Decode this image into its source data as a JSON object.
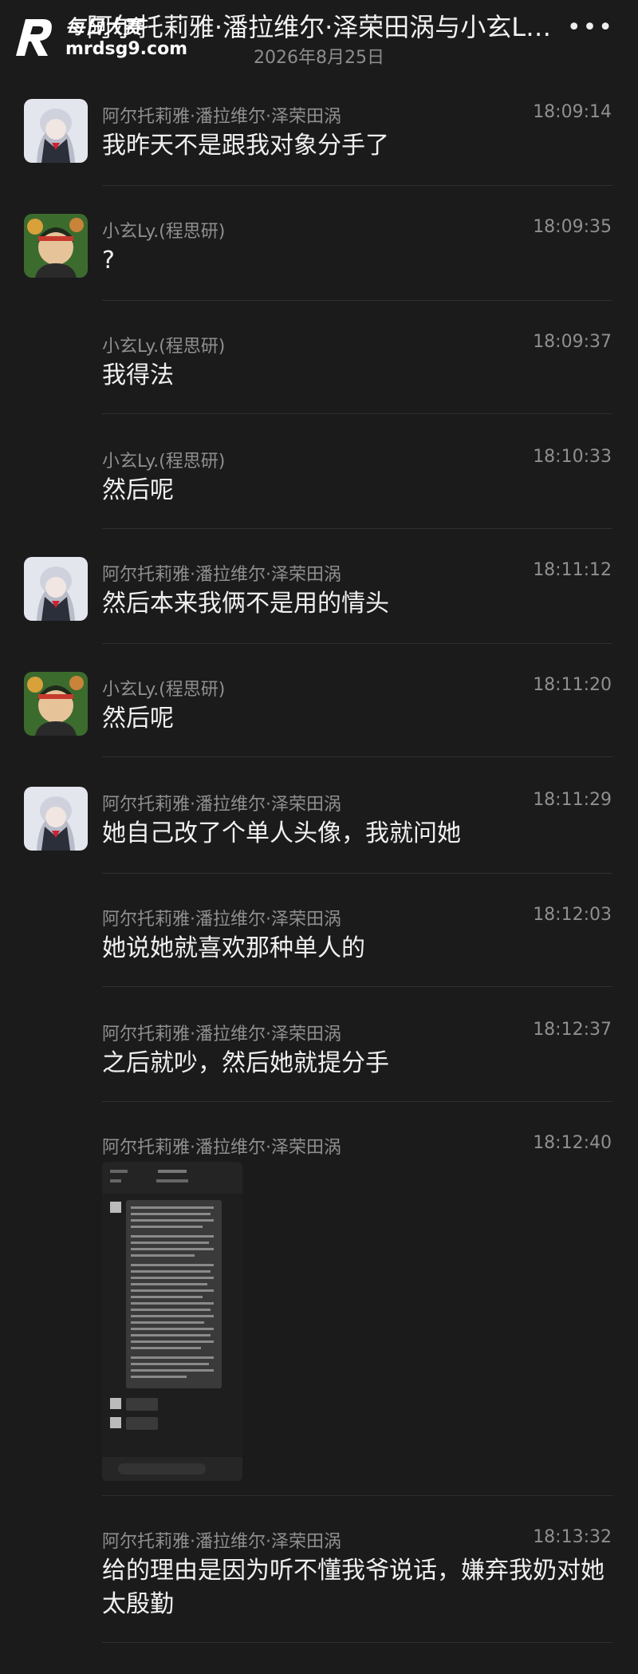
{
  "header": {
    "title": "阿尔托莉雅·潘拉维尔·泽荣田涡与小玄L…",
    "date": "2026年8月25日",
    "more_icon": "more-icon"
  },
  "watermark": {
    "cn": "每日大赛",
    "url": "mrdsg9.com"
  },
  "colors": {
    "background": "#1b1b1b",
    "name": "#8f8f8f",
    "text": "#f0f0f0"
  },
  "messages": [
    {
      "name": "阿尔托莉雅·潘拉维尔·泽荣田涡",
      "time": "18:09:14",
      "text": "我昨天不是跟我对象分手了"
    },
    {
      "name": "小玄Ly.(程思研)",
      "time": "18:09:35",
      "text": "?"
    },
    {
      "name": "小玄Ly.(程思研)",
      "time": "18:09:37",
      "text": "我得法"
    },
    {
      "name": "小玄Ly.(程思研)",
      "time": "18:10:33",
      "text": "然后呢"
    },
    {
      "name": "阿尔托莉雅·潘拉维尔·泽荣田涡",
      "time": "18:11:12",
      "text": "然后本来我俩不是用的情头"
    },
    {
      "name": "小玄Ly.(程思研)",
      "time": "18:11:20",
      "text": "然后呢"
    },
    {
      "name": "阿尔托莉雅·潘拉维尔·泽荣田涡",
      "time": "18:11:29",
      "text": "她自己改了个单人头像，我就问她"
    },
    {
      "name": "阿尔托莉雅·潘拉维尔·泽荣田涡",
      "time": "18:12:03",
      "text": "她说她就喜欢那种单人的"
    },
    {
      "name": "阿尔托莉雅·潘拉维尔·泽荣田涡",
      "time": "18:12:37",
      "text": "之后就吵，然后她就提分手"
    },
    {
      "name": "阿尔托莉雅·潘拉维尔·泽荣田涡",
      "time": "18:12:40",
      "text": ""
    },
    {
      "name": "阿尔托莉雅·潘拉维尔·泽荣田涡",
      "time": "18:13:32",
      "text": "给的理由是因为听不懂我爷说话，嫌弃我奶对她太殷勤"
    }
  ]
}
